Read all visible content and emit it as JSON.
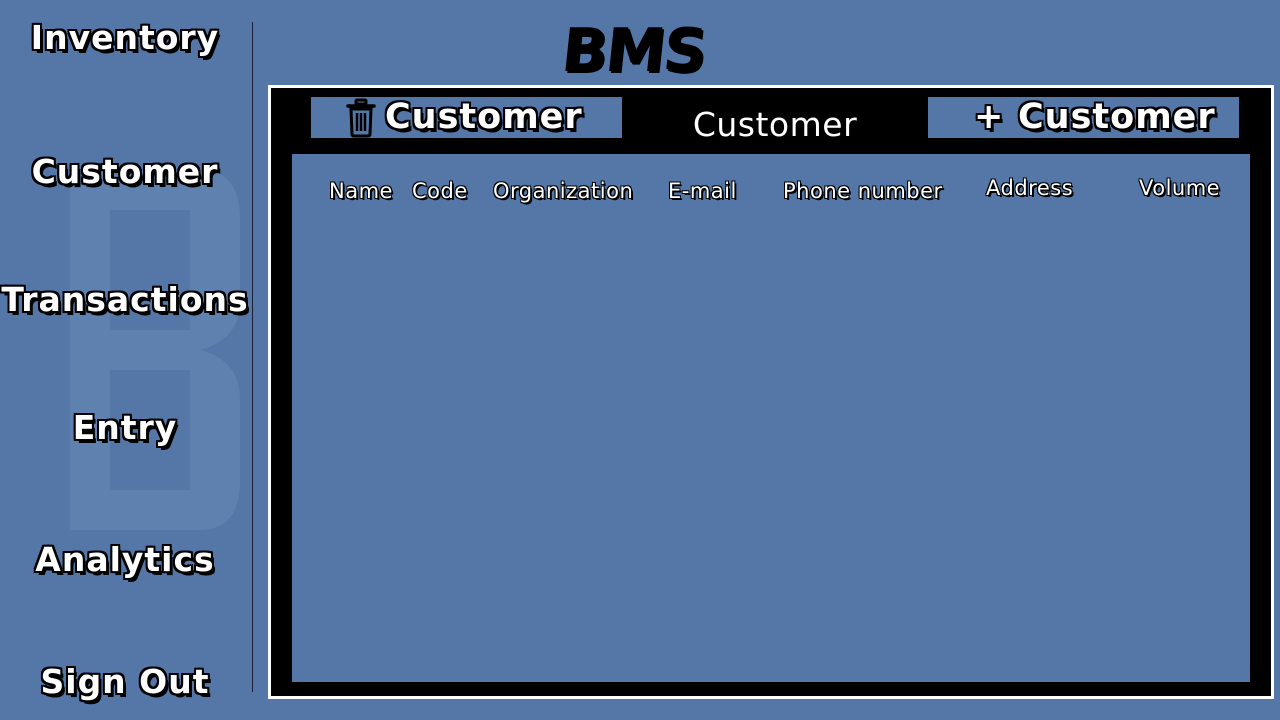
{
  "app": {
    "logo": "BMS"
  },
  "sidebar": {
    "items": [
      {
        "label": "Inventory"
      },
      {
        "label": "Customer"
      },
      {
        "label": "Transactions"
      },
      {
        "label": "Entry"
      },
      {
        "label": "Analytics"
      },
      {
        "label": "Sign Out"
      }
    ]
  },
  "toolbar": {
    "delete_label": "Customer",
    "delete_icon": "trash-icon",
    "current_label": "Customer",
    "add_prefix": "+",
    "add_label": "Customer"
  },
  "table": {
    "columns": [
      "Name",
      "Code",
      "Organization",
      "E-mail",
      "Phone number",
      "Address",
      "Volume"
    ],
    "rows": []
  },
  "colors": {
    "background": "#5577a8",
    "frame": "#000000",
    "frame_border": "#ffffff"
  }
}
